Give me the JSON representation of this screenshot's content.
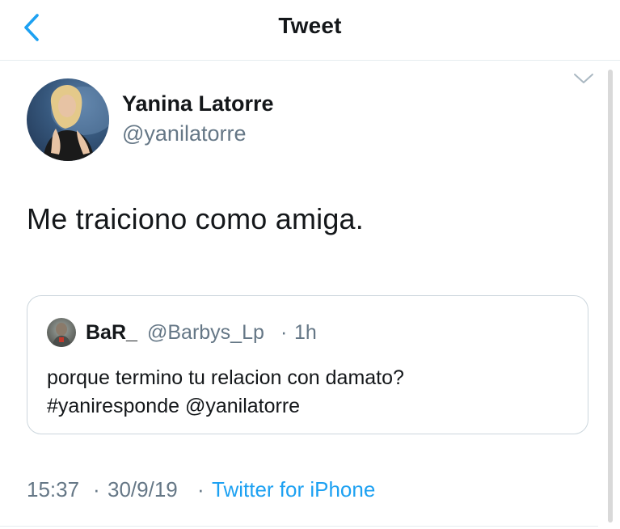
{
  "header": {
    "title": "Tweet",
    "back_icon": "chevron-left-icon",
    "accent_color": "#1da1f2"
  },
  "tweet": {
    "author": {
      "display_name": "Yanina Latorre",
      "handle": "@yanilatorre"
    },
    "text": "Me traiciono como amiga.",
    "menu_icon": "chevron-down-icon",
    "quoted": {
      "display_name": "BaR_",
      "handle": "@Barbys_Lp",
      "separator": "·",
      "time": "1h",
      "line1": "porque termino tu relacion con damato?",
      "line2": "#yaniresponde @yanilatorre"
    },
    "meta": {
      "time": "15:37",
      "separator": "·",
      "date": "30/9/19",
      "source": "Twitter for iPhone"
    }
  }
}
